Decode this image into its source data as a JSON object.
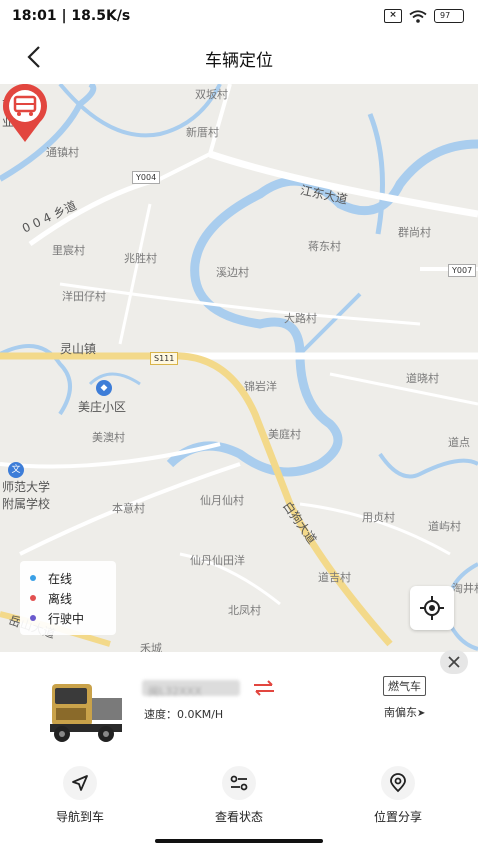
{
  "status_bar": {
    "time": "18:01 | 18.5K/s",
    "battery": "97"
  },
  "header": {
    "title": "车辆定位",
    "back_icon": "chevron-left-icon"
  },
  "map": {
    "labels": {
      "univ_tech": "南科技\n业大学",
      "shuangban": "双坂村",
      "xincuo": "新厝村",
      "tongzhen": "通镇村",
      "jiangdong": "江东大道",
      "xiangdao": "0 0 4 乡道",
      "lichen": "里宸村",
      "yaoshi": "兆胜村",
      "jianghu": "蒋东村",
      "yueyang": "群尚村",
      "linbian": "溪边村",
      "yangtian": "洋田仔村",
      "dahu": "大路村",
      "lingshan": "灵山镇",
      "meizhuang": "美庄小区",
      "keng": "锦岩洋",
      "daochuan": "道晓村",
      "meiao": "美澳村",
      "meiting": "美庭村",
      "yumin": "道点",
      "normal_univ": "师范大学\n附属学校",
      "benyi": "本意村",
      "xianyue": "仙月仙村",
      "xianchen": "用贞村",
      "baima": "白狗大道",
      "daoyu": "道屿村",
      "xiantian": "仙丹仙田洋",
      "daoji": "道吉村",
      "beifeng": "北凤村",
      "lanshan": "岳山大道",
      "taojing": "淘井村",
      "hecheng": "禾城"
    },
    "road_tags": {
      "y004": "Y004",
      "y007": "Y007",
      "s111": "S111"
    },
    "legend": [
      {
        "label": "在线",
        "color": "#3aa0e6"
      },
      {
        "label": "离线",
        "color": "#e25050"
      },
      {
        "label": "行驶中",
        "color": "#6a5acd"
      }
    ],
    "locate_icon": "crosshair-icon",
    "marker_icon": "truck-marker-icon"
  },
  "vehicle": {
    "plate": "闽L32XXX",
    "speed_label": "速度：0.0KM/H",
    "fuel_type": "燃气车",
    "direction": "南偏东",
    "swap_icon": "swap-arrows-icon",
    "close_icon": "close-icon"
  },
  "actions": [
    {
      "label": "导航到车",
      "icon": "navigation-arrow-icon"
    },
    {
      "label": "查看状态",
      "icon": "status-toggle-icon"
    },
    {
      "label": "位置分享",
      "icon": "location-pin-icon"
    }
  ],
  "colors": {
    "marker": "#e2463f",
    "river": "#a9cdee",
    "road": "#f3d98a",
    "map_bg": "#eeede9"
  }
}
